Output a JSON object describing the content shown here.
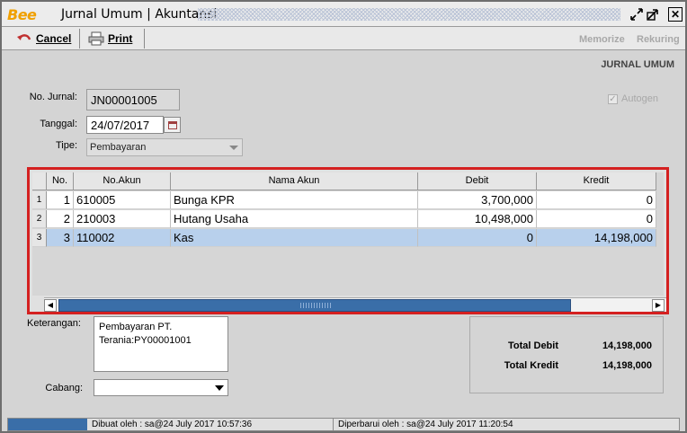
{
  "window": {
    "title": "Jurnal Umum | Akuntansi",
    "logo_text": "Bee"
  },
  "toolbar": {
    "cancel_label": "Cancel",
    "print_label": "Print",
    "memorize_label": "Memorize",
    "rekuring_label": "Rekuring"
  },
  "section_title": "JURNAL UMUM",
  "form": {
    "no_jurnal_label": "No. Jurnal:",
    "no_jurnal_value": "JN00001005",
    "tanggal_label": "Tanggal:",
    "tanggal_value": "24/07/2017",
    "tipe_label": "Tipe:",
    "tipe_value": "Pembayaran",
    "autogen_label": "Autogen",
    "autogen_checked": true
  },
  "table": {
    "headers": {
      "no": "No.",
      "no_akun": "No.Akun",
      "nama_akun": "Nama Akun",
      "debit": "Debit",
      "kredit": "Kredit"
    },
    "rows": [
      {
        "row_num": "1",
        "no": "1",
        "no_akun": "610005",
        "nama_akun": "Bunga KPR",
        "debit": "3,700,000",
        "kredit": "0"
      },
      {
        "row_num": "2",
        "no": "2",
        "no_akun": "210003",
        "nama_akun": "Hutang Usaha",
        "debit": "10,498,000",
        "kredit": "0"
      },
      {
        "row_num": "3",
        "no": "3",
        "no_akun": "110002",
        "nama_akun": "Kas",
        "debit": "0",
        "kredit": "14,198,000"
      }
    ],
    "selected_row": 3
  },
  "keterangan": {
    "label": "Keterangan:",
    "line1": "Pembayaran PT.",
    "line2": "Terania:PY00001001"
  },
  "cabang": {
    "label": "Cabang:",
    "value": ""
  },
  "totals": {
    "debit_label": "Total Debit",
    "debit_value": "14,198,000",
    "kredit_label": "Total Kredit",
    "kredit_value": "14,198,000"
  },
  "status": {
    "created": "Dibuat oleh : sa@24 July 2017  10:57:36",
    "updated": "Diperbarui oleh : sa@24 July 2017  11:20:54"
  }
}
